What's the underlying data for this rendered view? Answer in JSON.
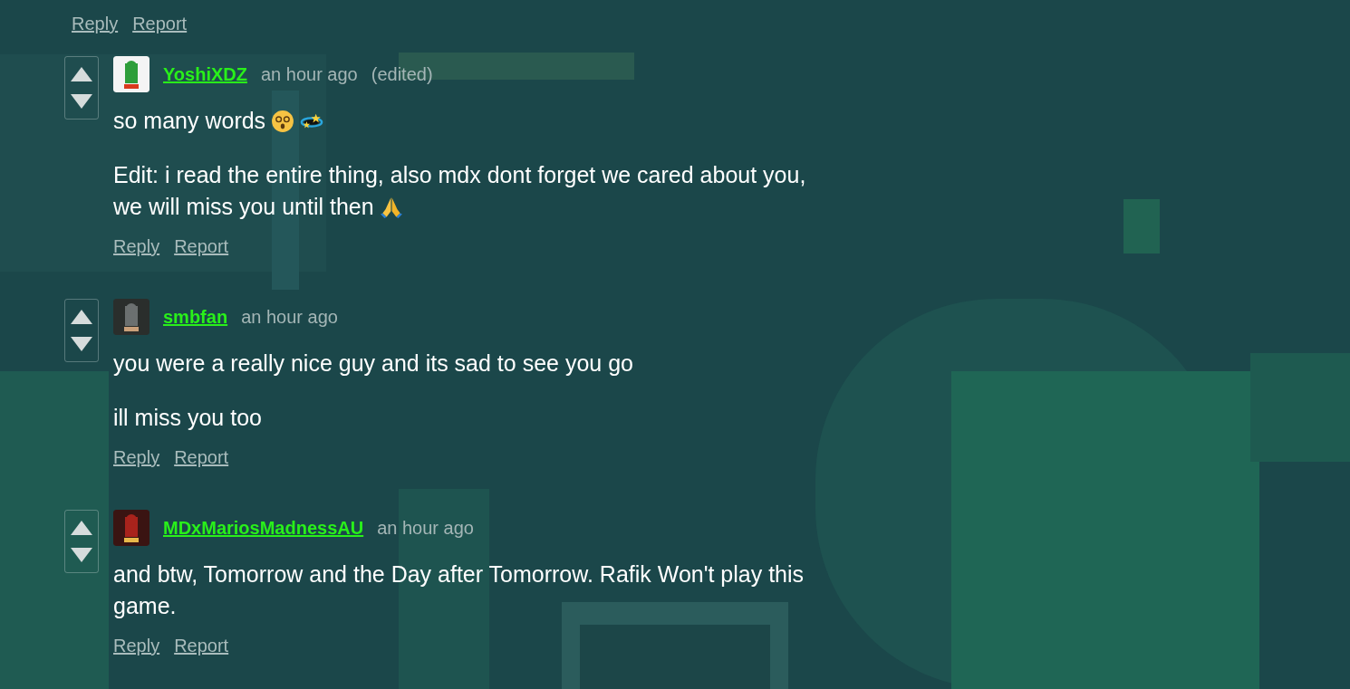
{
  "top_actions": [
    "Reply",
    "Report"
  ],
  "comments": [
    {
      "username": "YoshiXDZ",
      "time": "an hour ago",
      "edited": "(edited)",
      "paragraphs": [
        {
          "text": "so many words",
          "icons": [
            {
              "kind": "dizzy-face"
            },
            {
              "kind": "dizzy-stars"
            }
          ]
        },
        {
          "text": "Edit: i read the entire thing, also mdx dont forget we cared about you, we will miss you until then",
          "icons": [
            {
              "kind": "folded-hands"
            }
          ]
        }
      ],
      "actions": [
        "Reply",
        "Report"
      ]
    },
    {
      "username": "smbfan",
      "time": "an hour ago",
      "paragraphs": [
        {
          "text": "you were a really nice guy and its sad to see you go"
        },
        {
          "text": "ill miss you too"
        }
      ],
      "actions": [
        "Reply",
        "Report"
      ]
    },
    {
      "username": "MDxMariosMadnessAU",
      "time": "an hour ago",
      "paragraphs": [
        {
          "text": "and btw, Tomorrow and the Day after Tomorrow. Rafik Won't play this game."
        }
      ],
      "actions": [
        "Reply",
        "Report"
      ]
    }
  ]
}
